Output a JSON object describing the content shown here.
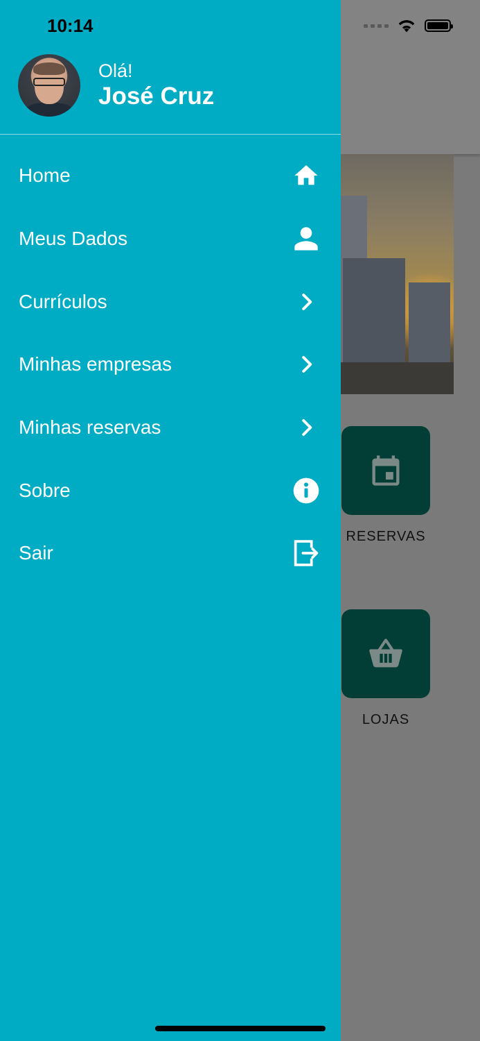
{
  "status_bar": {
    "time": "10:14"
  },
  "drawer": {
    "profile": {
      "greeting": "Olá!",
      "name": "José Cruz"
    },
    "menu": [
      {
        "label": "Home",
        "icon": "home-icon"
      },
      {
        "label": "Meus Dados",
        "icon": "person-icon"
      },
      {
        "label": "Currículos",
        "icon": "chevron-right-icon"
      },
      {
        "label": "Minhas empresas",
        "icon": "chevron-right-icon"
      },
      {
        "label": "Minhas reservas",
        "icon": "chevron-right-icon"
      },
      {
        "label": "Sobre",
        "icon": "info-icon"
      },
      {
        "label": "Sair",
        "icon": "logout-icon"
      }
    ]
  },
  "background": {
    "tiles": [
      {
        "label": "RESERVAS",
        "icon": "calendar-icon"
      },
      {
        "label": "LOJAS",
        "icon": "basket-icon"
      }
    ]
  },
  "colors": {
    "drawer": "#00abc4",
    "tile": "#023d36",
    "overlay": "#7a7a7a"
  }
}
